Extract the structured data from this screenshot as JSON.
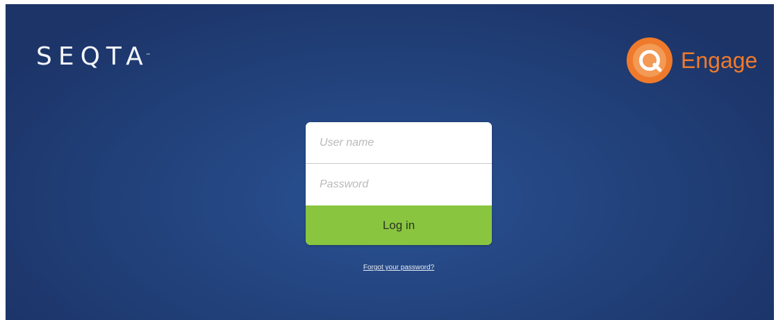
{
  "brand": {
    "logo_text": "SEQTA",
    "logo_mark": "™",
    "product_name": "Engage",
    "product_icon": "engage-q-icon"
  },
  "login": {
    "username_placeholder": "User name",
    "password_placeholder": "Password",
    "username_value": "",
    "password_value": "",
    "button_label": "Log in",
    "forgot_label": "Forgot your password?"
  },
  "colors": {
    "background": "#23447f",
    "accent_orange": "#f07a2b",
    "button_green": "#89c53f"
  }
}
